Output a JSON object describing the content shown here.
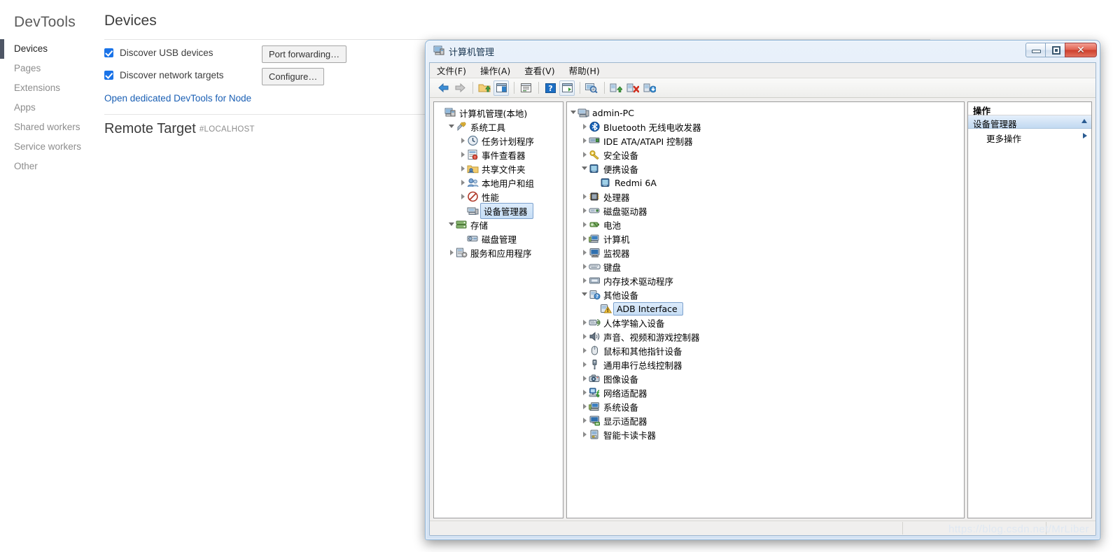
{
  "devtools": {
    "brand": "DevTools",
    "nav": [
      {
        "label": "Devices",
        "active": true
      },
      {
        "label": "Pages",
        "active": false
      },
      {
        "label": "Extensions",
        "active": false
      },
      {
        "label": "Apps",
        "active": false
      },
      {
        "label": "Shared workers",
        "active": false
      },
      {
        "label": "Service workers",
        "active": false
      },
      {
        "label": "Other",
        "active": false
      }
    ],
    "page_title": "Devices",
    "checkboxes": [
      {
        "label": "Discover USB devices",
        "checked": true
      },
      {
        "label": "Discover network targets",
        "checked": true
      }
    ],
    "buttons": {
      "port_forwarding": "Port forwarding…",
      "configure": "Configure…"
    },
    "node_link": "Open dedicated DevTools for Node",
    "remote_target": {
      "title": "Remote Target",
      "hash": "#LOCALHOST"
    },
    "accent_color": "#1a73e8",
    "link_color": "#1a5fb4"
  },
  "cmwin": {
    "title": "计算机管理",
    "window_buttons": {
      "minimize": "minimize-icon",
      "maximize": "maximize-icon",
      "close": "✕"
    },
    "menu": [
      "文件(F)",
      "操作(A)",
      "查看(V)",
      "帮助(H)"
    ],
    "toolbar_icons": [
      "back-arrow-icon",
      "forward-arrow-icon",
      "up-folder-icon",
      "show-hide-console-tree-icon",
      "properties-icon",
      "help-icon",
      "show-action-pane-icon",
      "scan-hardware-changes-icon",
      "update-driver-icon",
      "disable-device-icon",
      "uninstall-device-icon"
    ],
    "left_tree": [
      {
        "label": "计算机管理(本地)",
        "depth": 0,
        "state": "none",
        "icon": "computer-management-icon"
      },
      {
        "label": "系统工具",
        "depth": 1,
        "state": "open",
        "icon": "system-tools-icon"
      },
      {
        "label": "任务计划程序",
        "depth": 2,
        "state": "closed",
        "icon": "task-scheduler-icon"
      },
      {
        "label": "事件查看器",
        "depth": 2,
        "state": "closed",
        "icon": "event-viewer-icon"
      },
      {
        "label": "共享文件夹",
        "depth": 2,
        "state": "closed",
        "icon": "shared-folders-icon"
      },
      {
        "label": "本地用户和组",
        "depth": 2,
        "state": "closed",
        "icon": "local-users-groups-icon"
      },
      {
        "label": "性能",
        "depth": 2,
        "state": "closed",
        "icon": "performance-icon"
      },
      {
        "label": "设备管理器",
        "depth": 2,
        "state": "none",
        "icon": "device-manager-icon",
        "selected": true
      },
      {
        "label": "存储",
        "depth": 1,
        "state": "open",
        "icon": "storage-icon"
      },
      {
        "label": "磁盘管理",
        "depth": 2,
        "state": "none",
        "icon": "disk-management-icon"
      },
      {
        "label": "服务和应用程序",
        "depth": 1,
        "state": "closed",
        "icon": "services-applications-icon"
      }
    ],
    "device_tree": [
      {
        "label": "admin-PC",
        "depth": 0,
        "state": "open",
        "icon": "computer-icon"
      },
      {
        "label": "Bluetooth 无线电收发器",
        "depth": 1,
        "state": "closed",
        "icon": "bluetooth-icon"
      },
      {
        "label": "IDE ATA/ATAPI 控制器",
        "depth": 1,
        "state": "closed",
        "icon": "ide-controller-icon"
      },
      {
        "label": "安全设备",
        "depth": 1,
        "state": "closed",
        "icon": "security-device-icon"
      },
      {
        "label": "便携设备",
        "depth": 1,
        "state": "open",
        "icon": "portable-device-icon"
      },
      {
        "label": "Redmi 6A",
        "depth": 2,
        "state": "none",
        "icon": "portable-device-icon"
      },
      {
        "label": "处理器",
        "depth": 1,
        "state": "closed",
        "icon": "processor-icon"
      },
      {
        "label": "磁盘驱动器",
        "depth": 1,
        "state": "closed",
        "icon": "disk-drive-icon"
      },
      {
        "label": "电池",
        "depth": 1,
        "state": "closed",
        "icon": "battery-icon"
      },
      {
        "label": "计算机",
        "depth": 1,
        "state": "closed",
        "icon": "computer-node-icon"
      },
      {
        "label": "监视器",
        "depth": 1,
        "state": "closed",
        "icon": "monitor-icon"
      },
      {
        "label": "键盘",
        "depth": 1,
        "state": "closed",
        "icon": "keyboard-icon"
      },
      {
        "label": "内存技术驱动程序",
        "depth": 1,
        "state": "closed",
        "icon": "memory-tech-driver-icon"
      },
      {
        "label": "其他设备",
        "depth": 1,
        "state": "open",
        "icon": "other-devices-icon"
      },
      {
        "label": "ADB Interface",
        "depth": 2,
        "state": "none",
        "icon": "unknown-device-warning-icon",
        "selected": true
      },
      {
        "label": "人体学输入设备",
        "depth": 1,
        "state": "closed",
        "icon": "hid-icon"
      },
      {
        "label": "声音、视频和游戏控制器",
        "depth": 1,
        "state": "closed",
        "icon": "sound-video-game-icon"
      },
      {
        "label": "鼠标和其他指针设备",
        "depth": 1,
        "state": "closed",
        "icon": "mouse-icon"
      },
      {
        "label": "通用串行总线控制器",
        "depth": 1,
        "state": "closed",
        "icon": "usb-controller-icon"
      },
      {
        "label": "图像设备",
        "depth": 1,
        "state": "closed",
        "icon": "imaging-device-icon"
      },
      {
        "label": "网络适配器",
        "depth": 1,
        "state": "closed",
        "icon": "network-adapter-icon"
      },
      {
        "label": "系统设备",
        "depth": 1,
        "state": "closed",
        "icon": "system-device-icon"
      },
      {
        "label": "显示适配器",
        "depth": 1,
        "state": "closed",
        "icon": "display-adapter-icon"
      },
      {
        "label": "智能卡读卡器",
        "depth": 1,
        "state": "closed",
        "icon": "smart-card-reader-icon"
      }
    ],
    "actions": {
      "header": "操作",
      "section": "设备管理器",
      "item": "更多操作"
    },
    "statusbar": ""
  },
  "watermark": "https://blog.csdn.net/MrLiber"
}
